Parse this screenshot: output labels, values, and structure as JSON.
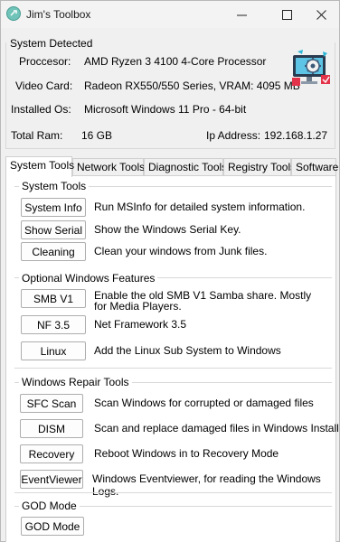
{
  "window": {
    "title": "Jim's Toolbox",
    "icons": {
      "app": "toolbox-app-icon",
      "minimize": "minimize-icon",
      "maximize": "maximize-icon",
      "close": "close-icon"
    }
  },
  "system": {
    "group_label": "System Detected",
    "processor_label": "Proccesor:",
    "processor_value": "AMD Ryzen 3 4100 4-Core Processor",
    "video_label": "Video Card:",
    "video_value": "Radeon RX550/550 Series, VRAM: 4095 MB",
    "os_label": "Installed Os:",
    "os_value": "Microsoft Windows 11 Pro - 64-bit",
    "ram_label": "Total Ram:",
    "ram_value": "16 GB",
    "ip_label": "Ip Address:",
    "ip_value": "192.168.1.27",
    "illustration": "computer-settings-illustration"
  },
  "tabs": [
    {
      "label": "System Tools",
      "active": true
    },
    {
      "label": "Network Tools",
      "active": false
    },
    {
      "label": "Diagnostic Tools",
      "active": false
    },
    {
      "label": "Registry Tools",
      "active": false
    },
    {
      "label": "Software",
      "active": false
    }
  ],
  "sections": {
    "system_tools": {
      "label": "System Tools",
      "items": [
        {
          "button": "System Info",
          "desc": "Run MSInfo for detailed system information."
        },
        {
          "button": "Show Serial",
          "desc": "Show the Windows Serial Key."
        },
        {
          "button": "Cleaning",
          "desc": "Clean your windows from Junk files."
        }
      ]
    },
    "optional_features": {
      "label": "Optional Windows Features",
      "items": [
        {
          "button": "SMB V1",
          "desc": "Enable the old SMB V1 Samba share. Mostly",
          "desc2": "for Media Players."
        },
        {
          "button": "NF 3.5",
          "desc": "Net Framework 3.5"
        },
        {
          "button": "Linux",
          "desc": "Add the Linux Sub System to Windows"
        }
      ]
    },
    "repair_tools": {
      "label": "Windows Repair Tools",
      "items": [
        {
          "button": "SFC Scan",
          "desc": "Scan Windows for corrupted or damaged files"
        },
        {
          "button": "DISM",
          "desc": "Scan and replace damaged files in Windows Install"
        },
        {
          "button": "Recovery",
          "desc": "Reboot Windows in to Recovery Mode"
        },
        {
          "button": "EventViewer",
          "desc": "Windows Eventviewer, for reading the Windows Logs."
        }
      ]
    },
    "god_mode": {
      "label": "GOD Mode",
      "items": [
        {
          "button": "GOD Mode"
        }
      ]
    }
  }
}
